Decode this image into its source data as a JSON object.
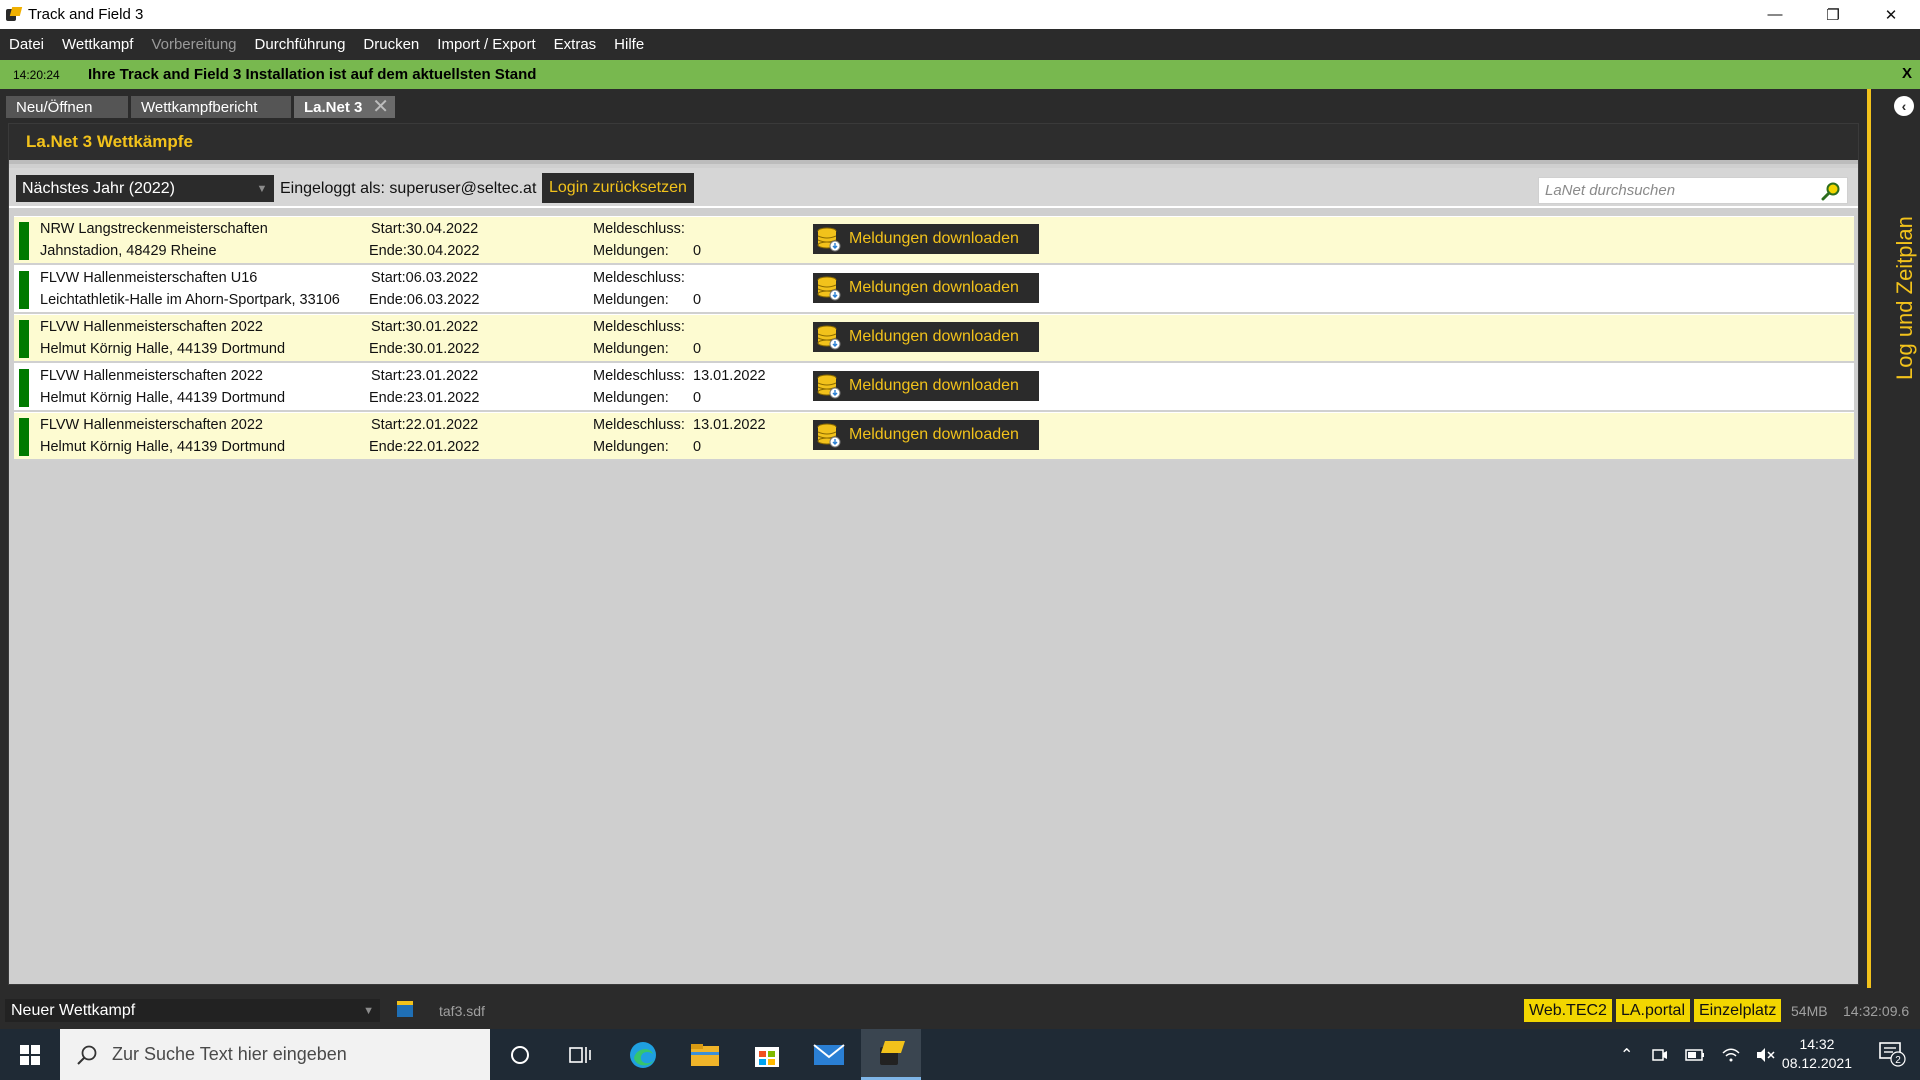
{
  "window": {
    "title": "Track and Field 3"
  },
  "menu": [
    {
      "label": "Datei",
      "enabled": true
    },
    {
      "label": "Wettkampf",
      "enabled": true
    },
    {
      "label": "Vorbereitung",
      "enabled": false
    },
    {
      "label": "Durchführung",
      "enabled": true
    },
    {
      "label": "Drucken",
      "enabled": true
    },
    {
      "label": "Import / Export",
      "enabled": true
    },
    {
      "label": "Extras",
      "enabled": true
    },
    {
      "label": "Hilfe",
      "enabled": true
    }
  ],
  "notification": {
    "time": "14:20:24",
    "message": "Ihre Track and Field 3 Installation ist auf dem aktuellsten Stand",
    "close": "X"
  },
  "tabs": [
    {
      "label": "Neu/Öffnen",
      "active": false
    },
    {
      "label": "Wettkampfbericht",
      "active": false
    },
    {
      "label": "La.Net 3",
      "active": true
    }
  ],
  "panel": {
    "title": "La.Net 3 Wettkämpfe",
    "year_select": "Nächstes Jahr (2022)",
    "logged_in_label": "Eingeloggt als:",
    "logged_in_user": "superuser@seltec.at",
    "login_reset": "Login zurücksetzen",
    "search_placeholder": "LaNet durchsuchen"
  },
  "labels": {
    "start": "Start:",
    "end": "Ende:",
    "meldeschluss": "Meldeschluss:",
    "meldungen": "Meldungen:",
    "download": "Meldungen downloaden"
  },
  "competitions": [
    {
      "name": "NRW Langstreckenmeisterschaften",
      "venue": "Jahnstadion, 48429 Rheine",
      "start": "30.04.2022",
      "end": "30.04.2022",
      "meldeschluss": "",
      "meldungen": "0",
      "highlight": true
    },
    {
      "name": "FLVW Hallenmeisterschaften U16",
      "venue": "Leichtathletik-Halle im Ahorn-Sportpark, 33106",
      "start": "06.03.2022",
      "end": "06.03.2022",
      "meldeschluss": "",
      "meldungen": "0",
      "highlight": false
    },
    {
      "name": "FLVW Hallenmeisterschaften 2022",
      "venue": "Helmut Körnig Halle, 44139 Dortmund",
      "start": "30.01.2022",
      "end": "30.01.2022",
      "meldeschluss": "",
      "meldungen": "0",
      "highlight": true
    },
    {
      "name": "FLVW Hallenmeisterschaften 2022",
      "venue": "Helmut Körnig Halle, 44139 Dortmund",
      "start": "23.01.2022",
      "end": "23.01.2022",
      "meldeschluss": "13.01.2022",
      "meldungen": "0",
      "highlight": false
    },
    {
      "name": "FLVW Hallenmeisterschaften 2022",
      "venue": "Helmut Körnig Halle, 44139 Dortmund",
      "start": "22.01.2022",
      "end": "22.01.2022",
      "meldeschluss": "13.01.2022",
      "meldungen": "0",
      "highlight": true
    }
  ],
  "sidebar": {
    "label": "Log und Zeitplan"
  },
  "statusbar": {
    "competition_select": "Neuer Wettkampf",
    "file": "taf3.sdf",
    "badges": [
      "Web.TEC2",
      "LA.portal",
      "Einzelplatz"
    ],
    "memory": "54MB",
    "clock": "14:32:09.6"
  },
  "taskbar": {
    "search_placeholder": "Zur Suche Text hier eingeben",
    "time": "14:32",
    "date": "08.12.2021",
    "notification_count": "2"
  },
  "colors": {
    "accent": "#f2c21b",
    "notification_bg": "#78b84f",
    "row_highlight": "#fdfbd1",
    "status_green": "#007a00",
    "dark_bg": "#2b2b2b"
  }
}
